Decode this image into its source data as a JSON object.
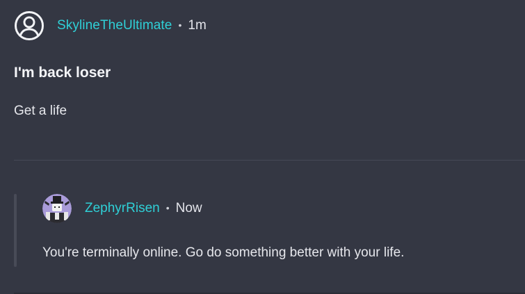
{
  "post": {
    "author": "SkylineTheUltimate",
    "separator_dot": "•",
    "timestamp": "1m",
    "title": "I'm back loser",
    "body": "Get a life",
    "avatar_icon": "user-circle-icon"
  },
  "reply": {
    "author": "ZephyrRisen",
    "separator_dot": "•",
    "timestamp": "Now",
    "body": "You're terminally online. Go do something better with your life.",
    "avatar_icon": "user-avatar-image"
  },
  "colors": {
    "background": "#343743",
    "username": "#2fd0d7",
    "text": "#e6e7ec",
    "divider": "#454957"
  }
}
